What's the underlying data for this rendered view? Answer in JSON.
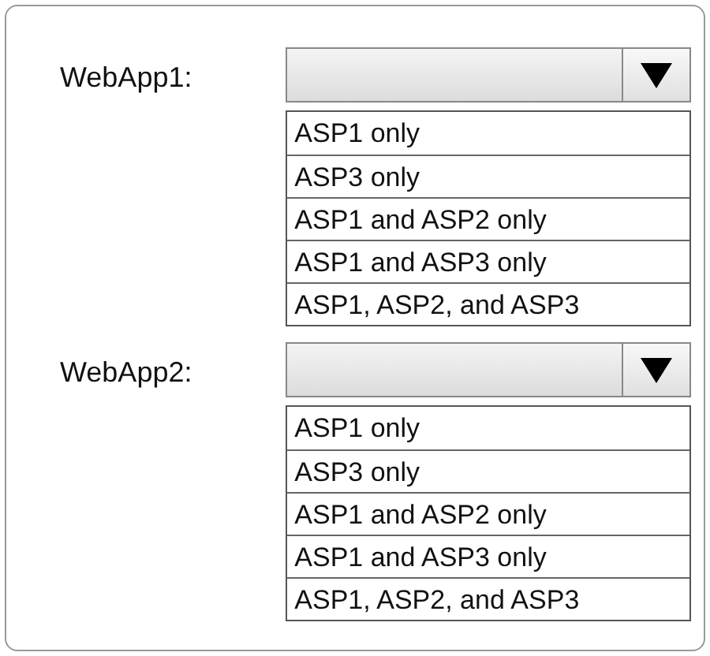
{
  "dropdowns": [
    {
      "label": "WebApp1:",
      "options": [
        "ASP1 only",
        "ASP3 only",
        "ASP1 and ASP2 only",
        "ASP1 and ASP3 only",
        "ASP1, ASP2, and ASP3"
      ]
    },
    {
      "label": "WebApp2:",
      "options": [
        "ASP1 only",
        "ASP3 only",
        "ASP1 and ASP2 only",
        "ASP1 and ASP3 only",
        "ASP1, ASP2, and ASP3"
      ]
    }
  ]
}
